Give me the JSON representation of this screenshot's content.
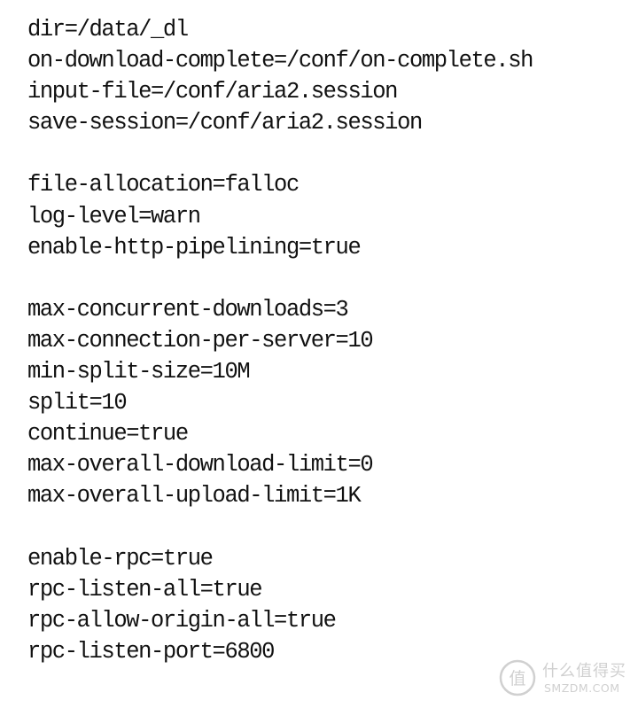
{
  "config": {
    "lines": [
      "dir=/data/_dl",
      "on-download-complete=/conf/on-complete.sh",
      "input-file=/conf/aria2.session",
      "save-session=/conf/aria2.session",
      "",
      "file-allocation=falloc",
      "log-level=warn",
      "enable-http-pipelining=true",
      "",
      "max-concurrent-downloads=3",
      "max-connection-per-server=10",
      "min-split-size=10M",
      "split=10",
      "continue=true",
      "max-overall-download-limit=0",
      "max-overall-upload-limit=1K",
      "",
      "enable-rpc=true",
      "rpc-listen-all=true",
      "rpc-allow-origin-all=true",
      "rpc-listen-port=6800"
    ]
  },
  "watermark": {
    "brand": "什么值得买",
    "domain": "SMZDM.COM",
    "seal_char": "值"
  }
}
